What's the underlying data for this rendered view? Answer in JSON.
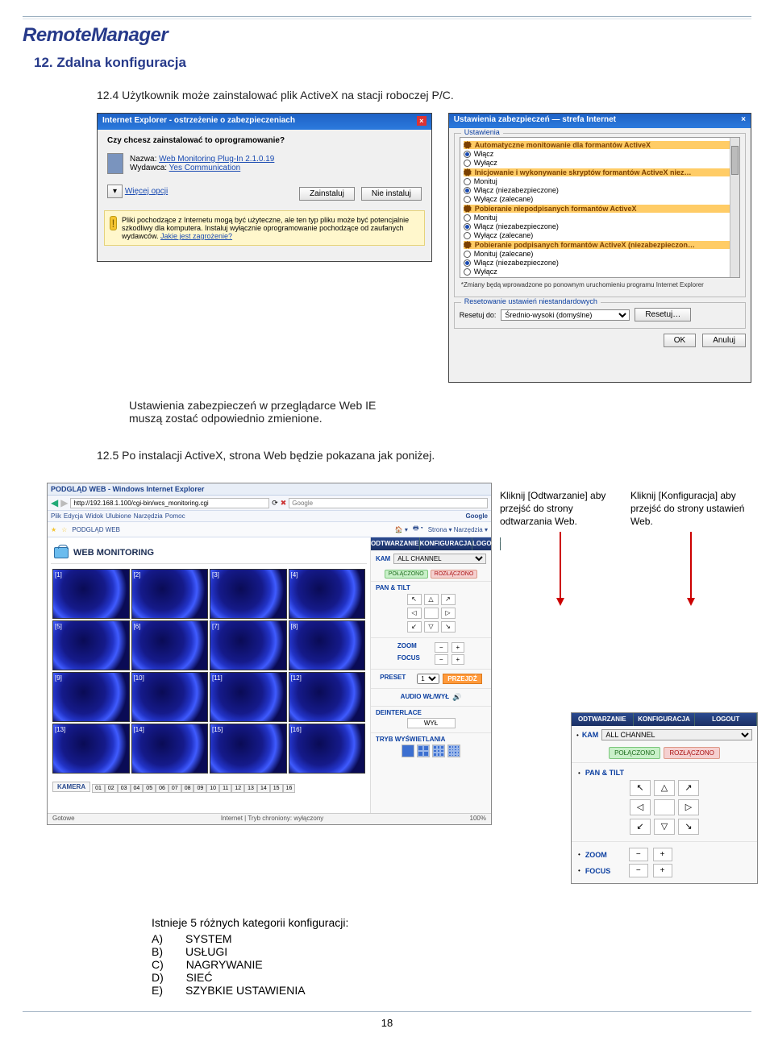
{
  "brand": "RemoteManager",
  "section_title": "12. Zdalna konfiguracja",
  "para_12_4": "12.4 Użytkownik może zainstalować plik ActiveX na stacji roboczej P/C.",
  "para_security": "Ustawienia zabezpieczeń w przeglądarce Web IE muszą zostać odpowiednio zmienione.",
  "para_12_5": "12.5 Po instalacji ActiveX, strona Web będzie pokazana jak poniżej.",
  "ie_prompt": {
    "title": "Internet Explorer - ostrzeżenie o zabezpieczeniach",
    "question": "Czy chcesz zainstalować to oprogramowanie?",
    "name_label": "Nazwa:",
    "name_value": "Web Monitoring Plug-In 2.1.0.19",
    "publisher_label": "Wydawca:",
    "publisher_value": "Yes Communication",
    "more_options": "Więcej opcji",
    "install": "Zainstaluj",
    "dont_install": "Nie instaluj",
    "notice": "Pliki pochodzące z Internetu mogą być użyteczne, ale ten typ pliku może być potencjalnie szkodliwy dla komputera. Instaluj wyłącznie oprogramowanie pochodzące od zaufanych wydawców.",
    "notice_link": "Jakie jest zagrożenie?"
  },
  "sec": {
    "title": "Ustawienia zabezpieczeń — strefa Internet",
    "group": "Ustawienia",
    "headers": {
      "auto": "Automatyczne monitowanie dla formantów ActiveX",
      "init": "Inicjowanie i wykonywanie skryptów formantów ActiveX niez…",
      "unsigned": "Pobieranie niepodpisanych formantów ActiveX",
      "signed": "Pobieranie podpisanych formantów ActiveX (niezabezpieczon…"
    },
    "opts": {
      "wlacz": "Włącz",
      "wylacz": "Wyłącz",
      "monituj": "Monituj",
      "wlacz_niezab": "Włącz (niezabezpieczone)",
      "wylacz_zalec": "Wyłącz (zalecane)",
      "monituj_zalec": "Monituj (zalecane)"
    },
    "note": "*Zmiany będą wprowadzone po ponownym uruchomieniu programu Internet Explorer",
    "reset_group": "Resetowanie ustawień niestandardowych",
    "reset_label": "Resetuj do:",
    "reset_level": "Średnio-wysoki (domyślne)",
    "reset_btn": "Resetuj…",
    "ok": "OK",
    "cancel": "Anuluj"
  },
  "browser": {
    "wintitle": "PODGLĄD WEB - Windows Internet Explorer",
    "url": "http://192.168.1.100/cgi-bin/wcs_monitoring.cgi",
    "search_placeholder": "Google",
    "toolbar": {
      "plik": "Plik",
      "edycja": "Edycja",
      "widok": "Widok",
      "ulubione": "Ulubione",
      "narzedzia": "Narzędzia",
      "pomoc": "Pomoc"
    },
    "fav_name": "PODGLĄD WEB",
    "tool_right": "Strona ▾  Narzędzia ▾",
    "wm_title": "WEB MONITORING",
    "channels": [
      "[1]",
      "[2]",
      "[3]",
      "[4]",
      "[5]",
      "[6]",
      "[7]",
      "[8]",
      "[9]",
      "[10]",
      "[11]",
      "[12]",
      "[13]",
      "[14]",
      "[15]",
      "[16]"
    ],
    "kamera_label": "KAMERA",
    "cam_buttons": [
      "01",
      "02",
      "03",
      "04",
      "05",
      "06",
      "07",
      "08",
      "09",
      "10",
      "11",
      "12",
      "13",
      "14",
      "15",
      "16"
    ],
    "tabs": {
      "odtw": "ODTWARZANIE",
      "konf": "KONFIGURACJA",
      "logout": "LOGOUT"
    },
    "side": {
      "kam": "KAM",
      "all_channel": "ALL CHANNEL",
      "polaczono": "POŁĄCZONO",
      "rozlaczono": "ROZŁĄCZONO",
      "pantilt": "PAN & TILT",
      "zoom": "ZOOM",
      "focus": "FOCUS",
      "plus": "+",
      "minus": "−",
      "preset": "PRESET",
      "preset_val": "1",
      "preset_go": "PRZEJDŹ",
      "audio": "AUDIO WŁ/WYŁ",
      "deinterlace": "DEINTERLACE",
      "wyl": "WYŁ",
      "tryb": "TRYB WYŚWIETLANIA"
    },
    "status_left": "Gotowe",
    "status_mid": "Internet | Tryb chroniony: wyłączony",
    "status_right": "100%"
  },
  "callout1": "Kliknij [Odtwarzanie] aby przejść do strony odtwarzania Web.",
  "callout2": "Kliknij [Konfiguracja] aby przejść do strony ustawień Web.",
  "configs": {
    "lead": "Istnieje 5 różnych kategorii konfiguracji:",
    "rows": [
      {
        "k": "A)",
        "v": "SYSTEM"
      },
      {
        "k": "B)",
        "v": "USŁUGI"
      },
      {
        "k": "C)",
        "v": "NAGRYWANIE"
      },
      {
        "k": "D)",
        "v": "SIEĆ"
      },
      {
        "k": "E)",
        "v": "SZYBKIE USTAWIENIA"
      }
    ]
  },
  "page_no": "18"
}
